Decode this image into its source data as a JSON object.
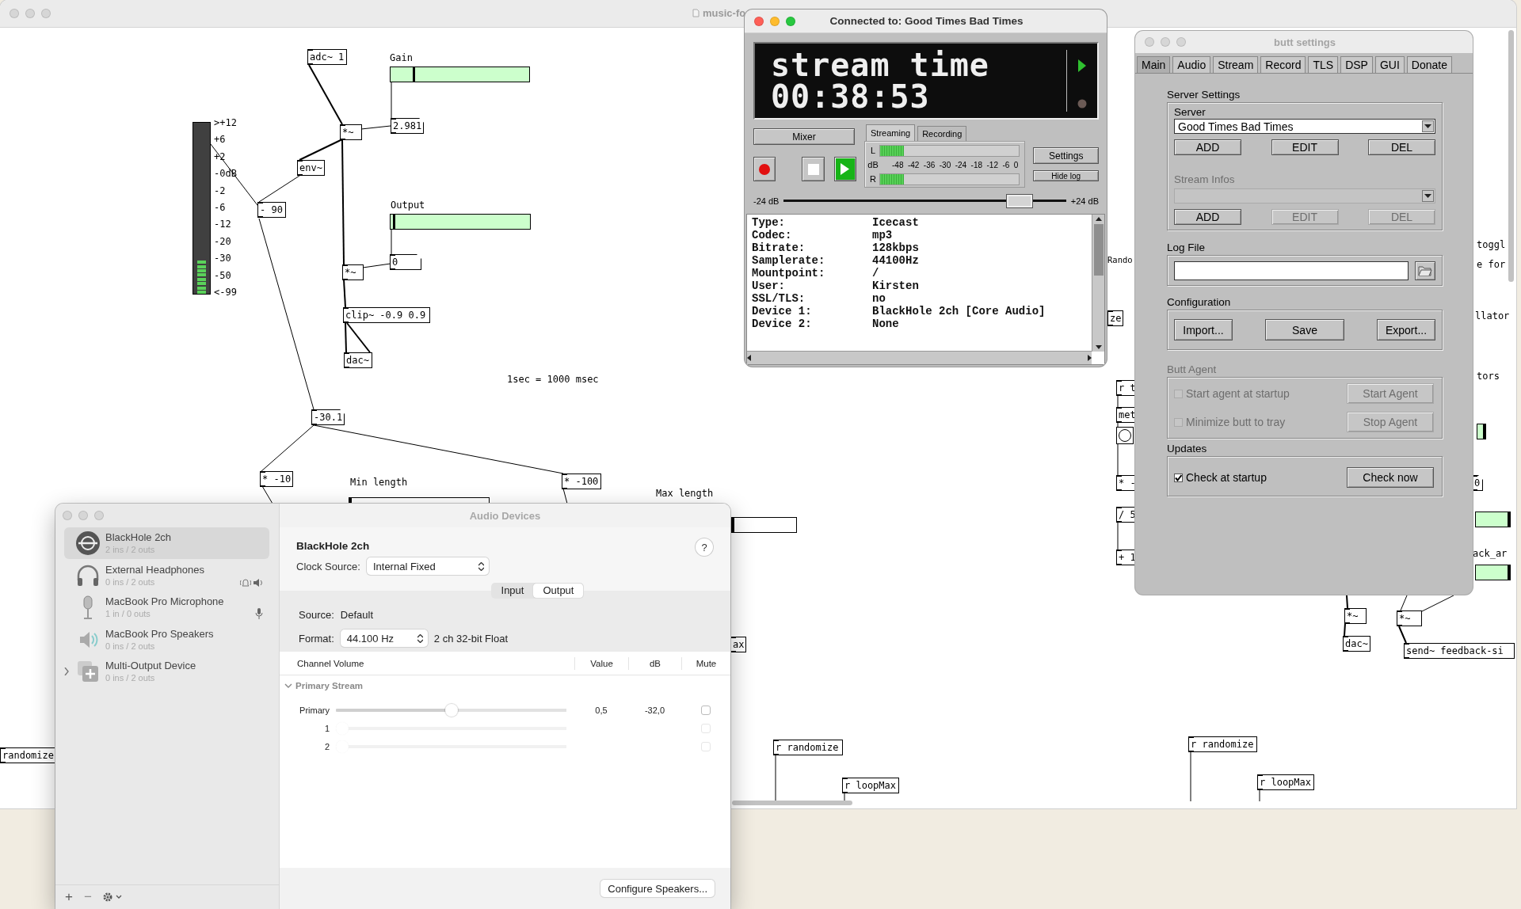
{
  "pd_window": {
    "title": "music-fo",
    "focused": false,
    "objects": [
      {
        "kind": "object",
        "text": "adc~ 1"
      },
      {
        "kind": "comment",
        "text": "Gain"
      },
      {
        "kind": "hslider",
        "level": 0.16,
        "color": "#ccffcc"
      },
      {
        "kind": "meter",
        "level": 0.2,
        "scale": [
          ">+12",
          "+6",
          "+2",
          "-0dB",
          "-2",
          "-6",
          "-12",
          "-20",
          "-30",
          "-50",
          "<-99"
        ]
      },
      {
        "kind": "object",
        "text": "*~"
      },
      {
        "kind": "number",
        "text": "2.981"
      },
      {
        "kind": "object",
        "text": "env~"
      },
      {
        "kind": "object",
        "text": "- 90"
      },
      {
        "kind": "comment",
        "text": "Output"
      },
      {
        "kind": "hslider",
        "level": 0.02,
        "color": "#ccffcc"
      },
      {
        "kind": "number",
        "text": "0"
      },
      {
        "kind": "object",
        "text": "*~"
      },
      {
        "kind": "object",
        "text": "clip~ -0.9 0.9"
      },
      {
        "kind": "object",
        "text": "dac~"
      },
      {
        "kind": "comment",
        "text": "1sec = 1000 msec"
      },
      {
        "kind": "number",
        "text": "-30.1"
      },
      {
        "kind": "object",
        "text": "* -10"
      },
      {
        "kind": "comment",
        "text": "Min length"
      },
      {
        "kind": "hslider",
        "level": 0
      },
      {
        "kind": "object",
        "text": "* -100"
      },
      {
        "kind": "comment",
        "text": "Max length"
      },
      {
        "kind": "hslider",
        "level": 0
      },
      {
        "kind": "object",
        "text": "ax"
      },
      {
        "kind": "object",
        "text": "randomize"
      },
      {
        "kind": "object",
        "text": "r randomize"
      },
      {
        "kind": "object",
        "text": "r loopMax"
      },
      {
        "kind": "comment",
        "text": "Rando"
      },
      {
        "kind": "object",
        "text": "ze"
      },
      {
        "kind": "object",
        "text": "r t"
      },
      {
        "kind": "object",
        "text": "met"
      },
      {
        "kind": "bang"
      },
      {
        "kind": "object",
        "text": "* -"
      },
      {
        "kind": "object",
        "text": "/ 5"
      },
      {
        "kind": "object",
        "text": "+ 1"
      },
      {
        "kind": "comment",
        "text": "toggl"
      },
      {
        "kind": "comment",
        "text": "e for"
      },
      {
        "kind": "comment",
        "text": "llator"
      },
      {
        "kind": "comment",
        "text": "tors"
      },
      {
        "kind": "hslider",
        "level": 1,
        "color": "#ccffcc"
      },
      {
        "kind": "number",
        "text": "0"
      },
      {
        "kind": "hslider",
        "level": 1,
        "color": "#ccffcc"
      },
      {
        "kind": "comment",
        "text": "ack_ar"
      },
      {
        "kind": "hslider",
        "level": 1,
        "color": "#ccffcc"
      },
      {
        "kind": "object",
        "text": "*~"
      },
      {
        "kind": "object",
        "text": "dac~"
      },
      {
        "kind": "object",
        "text": "*~"
      },
      {
        "kind": "object",
        "text": "send~ feedback-si"
      },
      {
        "kind": "object",
        "text": "r randomize"
      },
      {
        "kind": "object",
        "text": "r loopMax"
      }
    ]
  },
  "audio_devices": {
    "title": "Audio Devices",
    "focused": false,
    "devices": [
      {
        "kind": "virtual",
        "name": "BlackHole 2ch",
        "detail": "2 ins / 2 outs",
        "selected": true,
        "default_input": false,
        "default_output": false,
        "default_alert": false
      },
      {
        "kind": "headphones",
        "name": "External Headphones",
        "detail": "0 ins / 2 outs",
        "selected": false,
        "default_input": false,
        "default_output": true,
        "default_alert": true
      },
      {
        "kind": "microphone",
        "name": "MacBook Pro Microphone",
        "detail": "1 in / 0 outs",
        "selected": false,
        "default_input": true,
        "default_output": false,
        "default_alert": false
      },
      {
        "kind": "speakers",
        "name": "MacBook Pro Speakers",
        "detail": "0 ins / 2 outs",
        "selected": false,
        "default_input": false,
        "default_output": false,
        "default_alert": false
      },
      {
        "kind": "aggregate",
        "name": "Multi-Output Device",
        "detail": "0 ins / 2 outs",
        "selected": false,
        "default_input": false,
        "default_output": false,
        "default_alert": false,
        "expanded": false
      }
    ],
    "toolbar": [
      {
        "label": "+",
        "disabled": false
      },
      {
        "label": "−",
        "disabled": true
      }
    ],
    "device_name": "BlackHole 2ch",
    "help": "?",
    "clock_source_label": "Clock Source:",
    "clock_source": "Internal Fixed",
    "scopes": [
      {
        "label": "Input",
        "selected": false
      },
      {
        "label": "Output",
        "selected": true
      }
    ],
    "source_label": "Source:",
    "source": "Default",
    "format_label": "Format:",
    "format_rate": "44.100 Hz",
    "format_detail": "2 ch 32-bit Float",
    "columns": [
      "Channel Volume",
      "Value",
      "dB",
      "Mute"
    ],
    "stream": {
      "label": "Primary Stream",
      "expanded": true,
      "channels": [
        {
          "label": "Primary",
          "level": 0.5,
          "value": "0,5",
          "db": "-32,0",
          "muted": false,
          "disabled": false
        },
        {
          "label": "1",
          "level": 0,
          "muted": false,
          "disabled": true
        },
        {
          "label": "2",
          "level": 0,
          "muted": false,
          "disabled": true
        }
      ]
    },
    "configure_button": "Configure Speakers..."
  },
  "butt_window": {
    "title": "Connected to: Good Times Bad Times",
    "focused": true,
    "display": [
      "stream time",
      "00:38:53"
    ],
    "mixer": "Mixer",
    "transport": [
      {
        "kind": "record",
        "active": false
      },
      {
        "kind": "stop",
        "active": false
      },
      {
        "kind": "play",
        "active": true
      }
    ],
    "tabs": [
      {
        "label": "Streaming",
        "selected": true
      },
      {
        "label": "Recording",
        "selected": false
      }
    ],
    "meter": {
      "unit": "dB",
      "channels": [
        {
          "label": "L",
          "level": 0.17
        },
        {
          "label": "R",
          "level": 0.17
        }
      ],
      "ticks": [
        "-48",
        "-42",
        "-36",
        "-30",
        "-24",
        "-18",
        "-12",
        "-6",
        "0"
      ]
    },
    "settings_button": "Settings",
    "log_button": "Hide log",
    "gain": {
      "min_label": "-24 dB",
      "max_label": "+24 dB",
      "level": 0.87
    },
    "log": [
      {
        "label": "Type:",
        "value": "Icecast"
      },
      {
        "label": "Codec:",
        "value": "mp3"
      },
      {
        "label": "Bitrate:",
        "value": "128kbps"
      },
      {
        "label": "Samplerate:",
        "value": "44100Hz"
      },
      {
        "label": "Mountpoint:",
        "value": "/"
      },
      {
        "label": "User:",
        "value": "Kirsten"
      },
      {
        "label": "SSL/TLS:",
        "value": "no"
      },
      {
        "label": "Device 1:",
        "value": "BlackHole 2ch [Core Audio]"
      },
      {
        "label": "Device 2:",
        "value": "None"
      }
    ]
  },
  "butt_settings": {
    "title": "butt settings",
    "focused": false,
    "tabs": [
      {
        "label": "Main",
        "selected": true
      },
      {
        "label": "Audio",
        "selected": false
      },
      {
        "label": "Stream",
        "selected": false
      },
      {
        "label": "Record",
        "selected": false
      },
      {
        "label": "TLS",
        "selected": false
      },
      {
        "label": "DSP",
        "selected": false
      },
      {
        "label": "GUI",
        "selected": false
      },
      {
        "label": "Donate",
        "selected": false
      }
    ],
    "server_settings": {
      "heading": "Server Settings",
      "server_label": "Server",
      "server_value": "Good Times Bad Times",
      "server_buttons": [
        {
          "label": "ADD",
          "disabled": false
        },
        {
          "label": "EDIT",
          "disabled": false
        },
        {
          "label": "DEL",
          "disabled": false
        }
      ],
      "stream_infos_label": "Stream Infos",
      "stream_infos_disabled": true,
      "stream_infos_buttons": [
        {
          "label": "ADD",
          "disabled": false
        },
        {
          "label": "EDIT",
          "disabled": true
        },
        {
          "label": "DEL",
          "disabled": true
        }
      ]
    },
    "log_file": {
      "heading": "Log File"
    },
    "configuration": {
      "heading": "Configuration",
      "buttons": [
        "Import...",
        "Save",
        "Export..."
      ]
    },
    "butt_agent": {
      "heading": "Butt Agent",
      "disabled": true,
      "options": [
        {
          "label": "Start agent at startup",
          "checked": false
        },
        {
          "label": "Minimize butt to tray",
          "checked": false
        }
      ],
      "buttons": [
        "Start Agent",
        "Stop Agent"
      ]
    },
    "updates": {
      "heading": "Updates",
      "disabled": false,
      "options": [
        {
          "label": "Check at startup",
          "checked": true
        }
      ],
      "buttons": [
        "Check now"
      ]
    }
  }
}
